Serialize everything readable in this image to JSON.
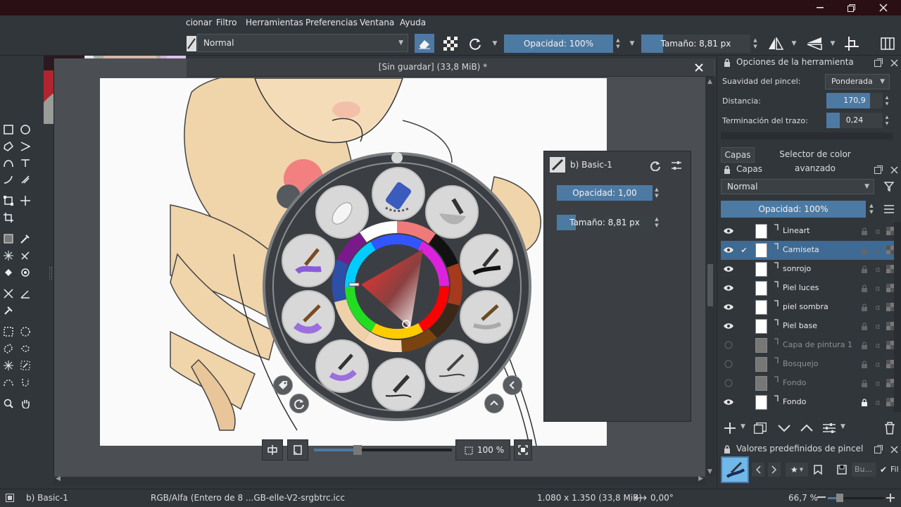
{
  "window": {
    "minimize_icon": "minimize-icon",
    "maximize_icon": "restore-icon",
    "close_icon": "close-icon"
  },
  "menu": {
    "items": [
      {
        "label": "cionar"
      },
      {
        "label": "Filtro"
      },
      {
        "label": "Herramientas"
      },
      {
        "label": "Preferencias"
      },
      {
        "label": "Ventana"
      },
      {
        "label": "Ayuda"
      }
    ]
  },
  "tool_options": {
    "blend_mode": "Normal",
    "opacity_label": "Opacidad: 100%",
    "opacity_value": 1.0,
    "size_label": "Tamaño: 8,81 px"
  },
  "document": {
    "title": "[Sin guardar]  (33,8 MiB) *"
  },
  "canvas_controls": {
    "zoom_label": "100 %"
  },
  "brush_hud": {
    "brush_name": "b) Basic-1",
    "opacity_label": "Opacidad: 1,00",
    "opacity_value": 1.0,
    "size_label": "Tamaño: 8,81 px",
    "size_fraction": 0.22
  },
  "tool_options_docker": {
    "title": "Opciones de la herramienta",
    "rows": [
      {
        "label": "Suavidad del pincel:",
        "value": "Ponderada"
      },
      {
        "label": "Distancia:",
        "value": "170,9",
        "fraction": 0.78
      },
      {
        "label": "Terminación del trazo:",
        "value": "0,24",
        "fraction": 0.24
      }
    ]
  },
  "tabs": [
    {
      "label": "Capas"
    },
    {
      "label": "Selector de color avanzado"
    }
  ],
  "layers_docker": {
    "title": "Capas",
    "blend_mode": "Normal",
    "opacity_label": "Opacidad:  100%",
    "layers": [
      {
        "name": "Lineart",
        "visible": true,
        "selected": false,
        "dim": false
      },
      {
        "name": "Camiseta",
        "visible": true,
        "selected": true,
        "dim": false
      },
      {
        "name": "sonrojo",
        "visible": true,
        "selected": false,
        "dim": false
      },
      {
        "name": "Piel luces",
        "visible": true,
        "selected": false,
        "dim": false
      },
      {
        "name": "piel sombra",
        "visible": true,
        "selected": false,
        "dim": false
      },
      {
        "name": "Piel base",
        "visible": true,
        "selected": false,
        "dim": false
      },
      {
        "name": "Capa de pintura 1",
        "visible": false,
        "selected": false,
        "dim": true
      },
      {
        "name": "Bosquejo",
        "visible": false,
        "selected": false,
        "dim": true
      },
      {
        "name": "Fondo",
        "visible": false,
        "selected": false,
        "dim": true
      },
      {
        "name": "Fondo",
        "visible": true,
        "selected": false,
        "dim": false
      }
    ]
  },
  "presets_docker": {
    "title": "Valores predefinidos de pincel",
    "search_placeholder": "Bu...",
    "filter_label": "Fil"
  },
  "status": {
    "brush": "b) Basic-1",
    "color_space": "RGB/Alfa (Entero de 8 ...GB-elle-V2-srgbtrc.icc",
    "dimensions": "1.080 x 1.350 (33,8 MiB)",
    "rotation": "0,00°",
    "zoom": "66,7 %"
  },
  "colors": {
    "accent": "#4d7aa3",
    "selection": "#3e6a93",
    "background": "#31363b"
  }
}
